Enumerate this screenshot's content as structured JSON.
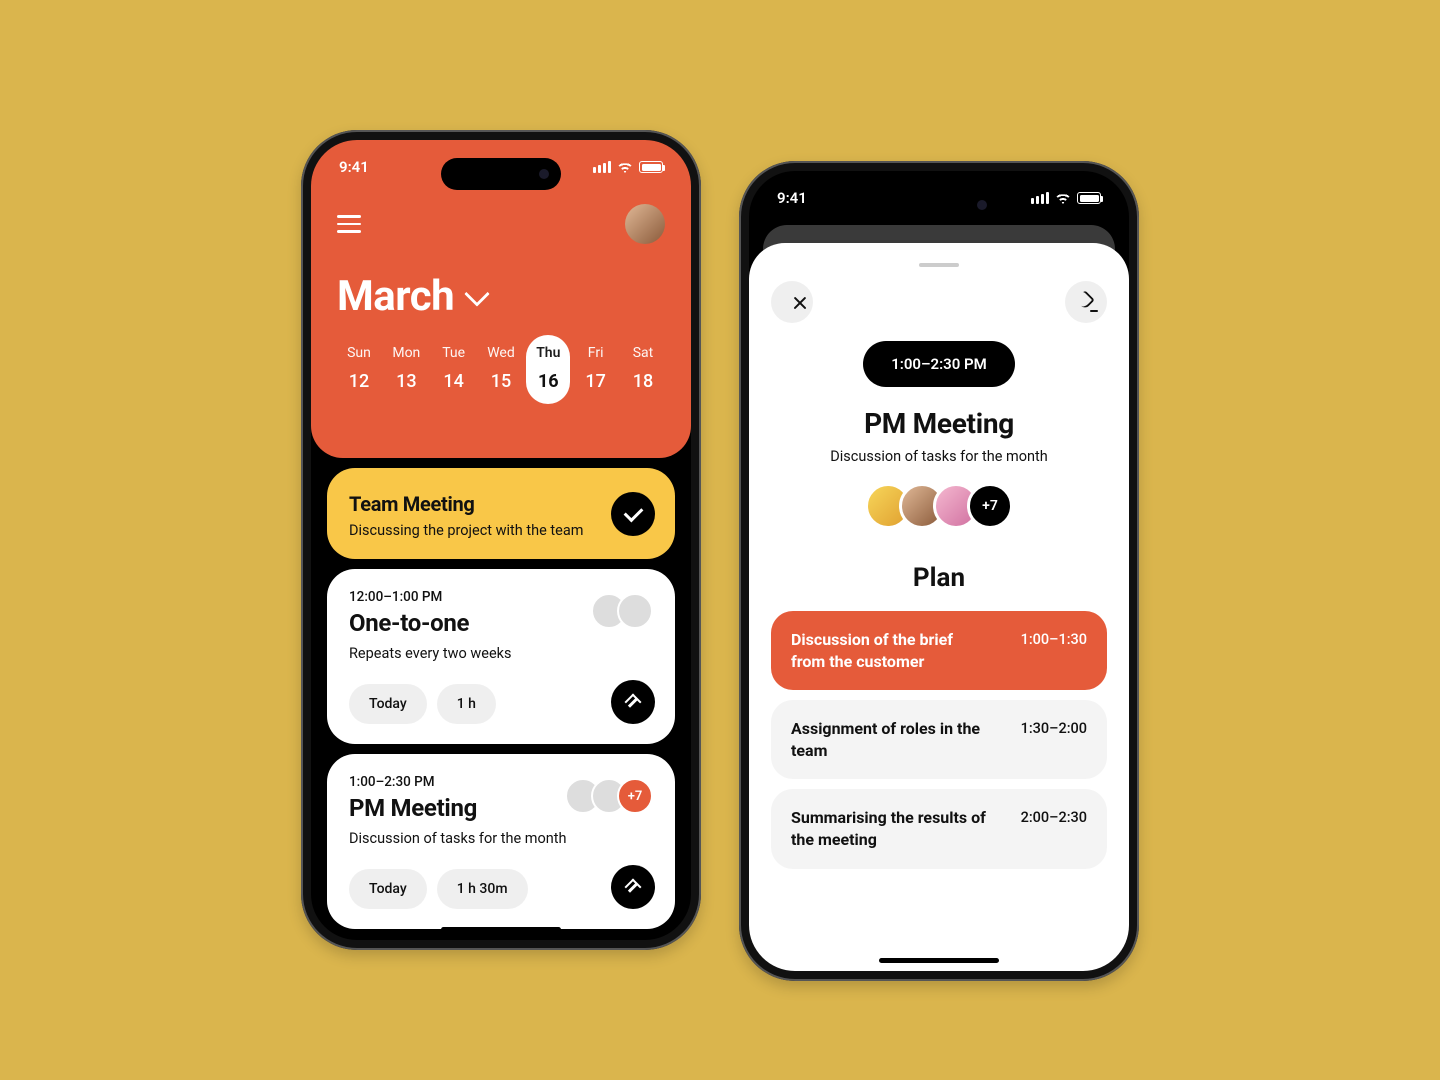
{
  "status": {
    "time": "9:41"
  },
  "calendar": {
    "month": "March",
    "days": [
      {
        "label": "Sun",
        "num": "12"
      },
      {
        "label": "Mon",
        "num": "13"
      },
      {
        "label": "Tue",
        "num": "14"
      },
      {
        "label": "Wed",
        "num": "15"
      },
      {
        "label": "Thu",
        "num": "16",
        "selected": true
      },
      {
        "label": "Fri",
        "num": "17"
      },
      {
        "label": "Sat",
        "num": "18"
      }
    ]
  },
  "events": {
    "featured": {
      "title": "Team Meeting",
      "subtitle": "Discussing the project with the team"
    },
    "one": {
      "time": "12:00–1:00 PM",
      "title": "One-to-one",
      "subtitle": "Repeats every two weeks",
      "badge1": "Today",
      "badge2": "1 h"
    },
    "two": {
      "time": "1:00–2:30 PM",
      "title": "PM Meeting",
      "subtitle": "Discussion of tasks for the month",
      "more": "+7",
      "badge1": "Today",
      "badge2": "1 h 30m"
    }
  },
  "detail": {
    "time": "1:00–2:30 PM",
    "title": "PM Meeting",
    "subtitle": "Discussion of tasks for the month",
    "more": "+7",
    "plan_heading": "Plan",
    "plan": [
      {
        "text": "Discussion of the brief from the customer",
        "range": "1:00–1:30"
      },
      {
        "text": "Assignment of roles in the team",
        "range": "1:30–2:00"
      },
      {
        "text": "Summarising the results of the meeting",
        "range": "2:00–2:30"
      }
    ]
  }
}
